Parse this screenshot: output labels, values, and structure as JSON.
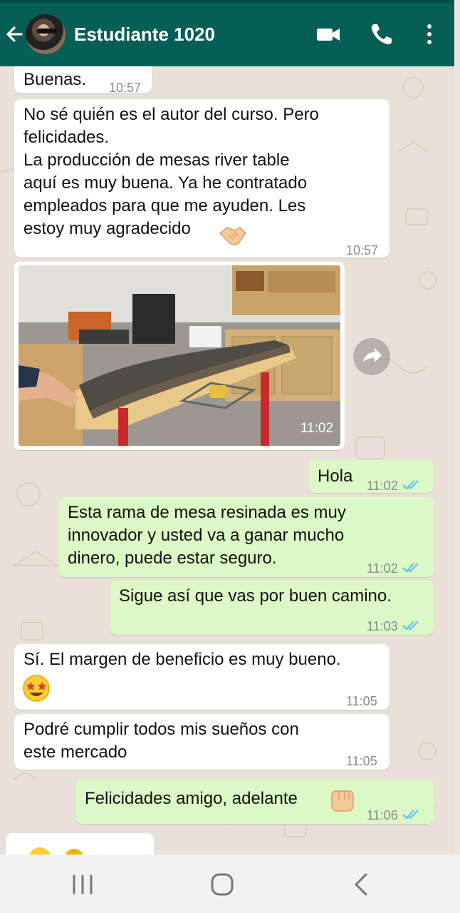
{
  "header": {
    "title": "Estudiante 1020"
  },
  "messages": [
    {
      "dir": "in",
      "text": "Buenas.",
      "time": "10:57"
    },
    {
      "dir": "in",
      "text": "No sé quién es el autor del curso. Pero\nfelicidades.\nLa producción de mesas river table\naquí es muy buena. Ya he contratado\nempleados para que me ayuden. Les\nestoy muy agradecido",
      "emoji": "handshake-emoji",
      "time": "10:57"
    },
    {
      "dir": "in",
      "type": "image",
      "time": "11:02"
    },
    {
      "dir": "out",
      "text": "Hola",
      "time": "11:02"
    },
    {
      "dir": "out",
      "text": "Esta rama de mesa resinada es muy\ninnovador y usted va a ganar mucho\ndinero, puede estar seguro.",
      "time": "11:02"
    },
    {
      "dir": "out",
      "text": "Sigue así que vas por buen camino.",
      "time": "11:03"
    },
    {
      "dir": "in",
      "text": "Sí. El margen de beneficio es muy bueno.",
      "emoji": "star-struck-emoji",
      "time": "11:05"
    },
    {
      "dir": "in",
      "text": "Podré cumplir todos mis sueños con\neste mercado",
      "time": "11:05"
    },
    {
      "dir": "out",
      "text": "Felicidades amigo, adelante",
      "emoji": "fist-bump-emoji",
      "time": "11:06"
    }
  ],
  "colors": {
    "header": "#075e54",
    "incoming_bubble": "#ffffff",
    "outgoing_bubble": "#dcf8c6",
    "read_ticks": "#4fc3f7"
  }
}
